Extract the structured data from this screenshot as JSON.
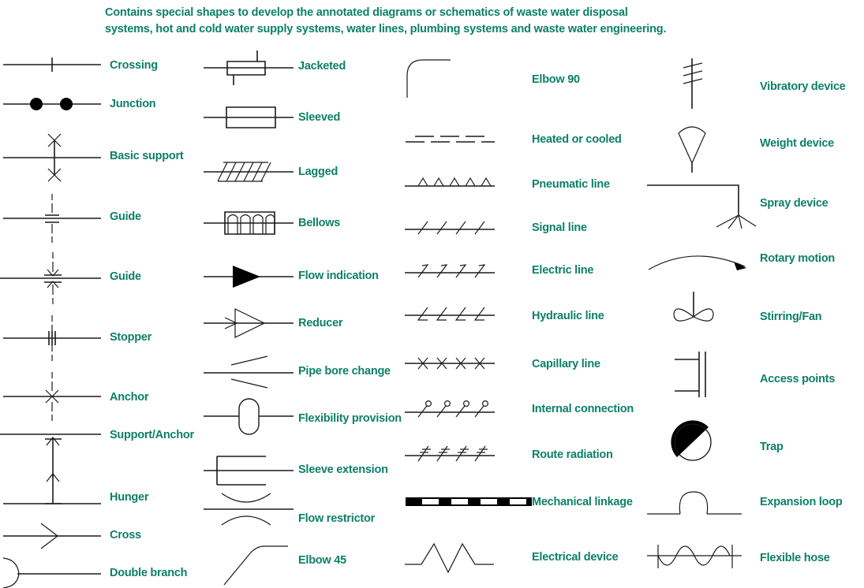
{
  "intro": {
    "line1": "Contains special shapes to develop the annotated diagrams or schematics of waste water disposal",
    "line2": "systems, hot and cold water supply systems, water lines, plumbing systems and waste water engineering."
  },
  "colors": {
    "label": "#0d8069",
    "stroke": "#1a1a1a",
    "background": "#ffffff"
  },
  "columns": [
    {
      "name": "column-1",
      "items": [
        {
          "label": "Crossing",
          "icon": "crossing-symbol"
        },
        {
          "label": "Junction",
          "icon": "junction-symbol"
        },
        {
          "label": "Basic support",
          "icon": "basic-support-symbol"
        },
        {
          "label": "Guide",
          "icon": "guide-symbol"
        },
        {
          "label": "Guide",
          "icon": "guide-arrows-symbol"
        },
        {
          "label": "Stopper",
          "icon": "stopper-symbol"
        },
        {
          "label": "Anchor",
          "icon": "anchor-symbol"
        },
        {
          "label": "Support/Anchor",
          "icon": "support-anchor-symbol"
        },
        {
          "label": "Hunger",
          "icon": "hunger-symbol"
        },
        {
          "label": "Cross",
          "icon": "cross-symbol"
        },
        {
          "label": "Double branch",
          "icon": "double-branch-symbol"
        }
      ]
    },
    {
      "name": "column-2",
      "items": [
        {
          "label": "Jacketed",
          "icon": "jacketed-symbol"
        },
        {
          "label": "Sleeved",
          "icon": "sleeved-symbol"
        },
        {
          "label": "Lagged",
          "icon": "lagged-symbol"
        },
        {
          "label": "Bellows",
          "icon": "bellows-symbol"
        },
        {
          "label": "Flow indication",
          "icon": "flow-indication-symbol"
        },
        {
          "label": "Reducer",
          "icon": "reducer-symbol"
        },
        {
          "label": "Pipe bore change",
          "icon": "pipe-bore-change-symbol"
        },
        {
          "label": "Flexibility provision",
          "icon": "flexibility-provision-symbol"
        },
        {
          "label": "Sleeve extension",
          "icon": "sleeve-extension-symbol"
        },
        {
          "label": "Flow restrictor",
          "icon": "flow-restrictor-symbol"
        },
        {
          "label": "Elbow 45",
          "icon": "elbow-45-symbol"
        }
      ]
    },
    {
      "name": "column-3",
      "items": [
        {
          "label": "Elbow 90",
          "icon": "elbow-90-symbol"
        },
        {
          "label": "Heated or cooled",
          "icon": "heated-or-cooled-symbol"
        },
        {
          "label": "Pneumatic line",
          "icon": "pneumatic-line-symbol"
        },
        {
          "label": "Signal line",
          "icon": "signal-line-symbol"
        },
        {
          "label": "Electric line",
          "icon": "electric-line-symbol"
        },
        {
          "label": "Hydraulic line",
          "icon": "hydraulic-line-symbol"
        },
        {
          "label": "Capillary line",
          "icon": "capillary-line-symbol"
        },
        {
          "label": "Internal connection",
          "icon": "internal-connection-symbol"
        },
        {
          "label": "Route radiation",
          "icon": "route-radiation-symbol"
        },
        {
          "label": "Mechanical linkage",
          "icon": "mechanical-linkage-symbol"
        },
        {
          "label": "Electrical device",
          "icon": "electrical-device-symbol"
        }
      ]
    },
    {
      "name": "column-4",
      "items": [
        {
          "label": "Vibratory device",
          "icon": "vibratory-device-symbol"
        },
        {
          "label": "Weight device",
          "icon": "weight-device-symbol"
        },
        {
          "label": "Spray device",
          "icon": "spray-device-symbol"
        },
        {
          "label": "Rotary motion",
          "icon": "rotary-motion-symbol"
        },
        {
          "label": "Stirring/Fan",
          "icon": "stirring-fan-symbol"
        },
        {
          "label": "Access points",
          "icon": "access-points-symbol"
        },
        {
          "label": "Trap",
          "icon": "trap-symbol"
        },
        {
          "label": "Expansion loop",
          "icon": "expansion-loop-symbol"
        },
        {
          "label": "Flexible hose",
          "icon": "flexible-hose-symbol"
        }
      ]
    }
  ]
}
